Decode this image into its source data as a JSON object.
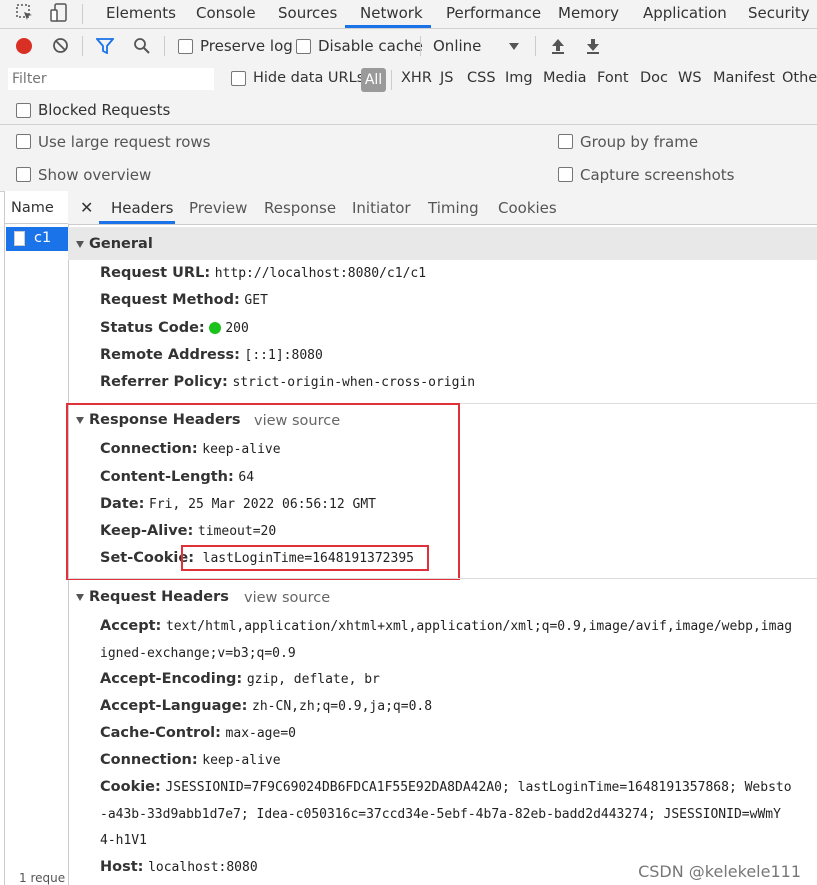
{
  "devtools": {
    "tabs": [
      "Elements",
      "Console",
      "Sources",
      "Network",
      "Performance",
      "Memory",
      "Application",
      "Security"
    ],
    "active_tab": "Network"
  },
  "toolbar": {
    "preserve_log": "Preserve log",
    "disable_cache": "Disable cache",
    "throttle": "Online"
  },
  "filterbar": {
    "placeholder": "Filter",
    "hide_data_urls": "Hide data URLs",
    "types": [
      "All",
      "XHR",
      "JS",
      "CSS",
      "Img",
      "Media",
      "Font",
      "Doc",
      "WS",
      "Manifest",
      "Other"
    ]
  },
  "blocked": "Blocked Requests",
  "options": {
    "large_rows": "Use large request rows",
    "group_by_frame": "Group by frame",
    "show_overview": "Show overview",
    "capture_screenshots": "Capture screenshots"
  },
  "request_list": {
    "header": "Name",
    "item": "c1",
    "status": "1 reque"
  },
  "detail": {
    "tabs": [
      "Headers",
      "Preview",
      "Response",
      "Initiator",
      "Timing",
      "Cookies"
    ],
    "general": {
      "title": "General",
      "rows": [
        {
          "k": "Request URL:",
          "v": "http://localhost:8080/c1/c1"
        },
        {
          "k": "Request Method:",
          "v": "GET"
        },
        {
          "k": "Status Code:",
          "v": "200"
        },
        {
          "k": "Remote Address:",
          "v": "[::1]:8080"
        },
        {
          "k": "Referrer Policy:",
          "v": "strict-origin-when-cross-origin"
        }
      ]
    },
    "response_headers": {
      "title": "Response Headers",
      "view_source": "view source",
      "rows": [
        {
          "k": "Connection:",
          "v": "keep-alive"
        },
        {
          "k": "Content-Length:",
          "v": "64"
        },
        {
          "k": "Date:",
          "v": "Fri, 25 Mar 2022 06:56:12 GMT"
        },
        {
          "k": "Keep-Alive:",
          "v": "timeout=20"
        },
        {
          "k": "Set-Cookie:",
          "v": "lastLoginTime=1648191372395"
        }
      ]
    },
    "request_headers": {
      "title": "Request Headers",
      "view_source": "view source",
      "accept_k": "Accept:",
      "accept_v": "text/html,application/xhtml+xml,application/xml;q=0.9,image/avif,image/webp,imag",
      "accept_v2": "igned-exchange;v=b3;q=0.9",
      "accept_encoding_k": "Accept-Encoding:",
      "accept_encoding_v": "gzip, deflate, br",
      "accept_language_k": "Accept-Language:",
      "accept_language_v": "zh-CN,zh;q=0.9,ja;q=0.8",
      "cache_control_k": "Cache-Control:",
      "cache_control_v": "max-age=0",
      "connection_k": "Connection:",
      "connection_v": "keep-alive",
      "cookie_k": "Cookie:",
      "cookie_v": "JSESSIONID=7F9C69024DB6FDCA1F55E92DA8DA42A0; lastLoginTime=1648191357868; Websto",
      "cookie_v2": "-a43b-33d9abb1d7e7; Idea-c050316c=37ccd34e-5ebf-4b7a-82eb-badd2d443274; JSESSIONID=wWmY",
      "cookie_v3": "4-h1V1",
      "host_k": "Host:",
      "host_v": "localhost:8080"
    }
  },
  "watermark": "CSDN @kelekele111"
}
